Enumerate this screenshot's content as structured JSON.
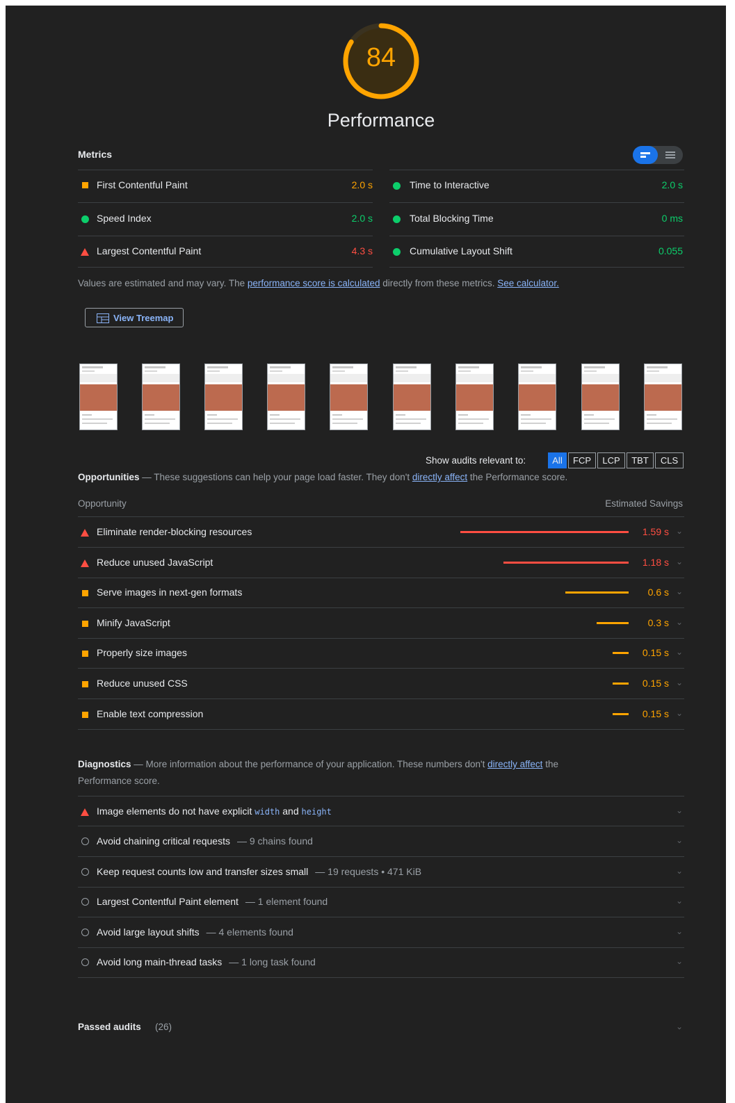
{
  "score": {
    "value": "84",
    "fraction": 0.84,
    "title": "Performance",
    "color": "#ffa400"
  },
  "colors": {
    "fail": "#ff4e42",
    "average": "#ffa400",
    "pass": "#0cce6b",
    "link": "#8ab4f8"
  },
  "metrics": {
    "heading": "Metrics",
    "left": [
      {
        "icon": "orange-square-icon",
        "label": "First Contentful Paint",
        "value": "2.0 s"
      },
      {
        "icon": "green-circle-icon",
        "label": "Speed Index",
        "value": "2.0 s"
      },
      {
        "icon": "red-triangle-icon",
        "label": "Largest Contentful Paint",
        "value": "4.3 s"
      }
    ],
    "right": [
      {
        "icon": "green-circle-icon",
        "label": "Time to Interactive",
        "value": "2.0 s"
      },
      {
        "icon": "green-circle-icon",
        "label": "Total Blocking Time",
        "value": "0 ms"
      },
      {
        "icon": "green-circle-icon",
        "label": "Cumulative Layout Shift",
        "value": "0.055"
      }
    ],
    "note": {
      "pre": "Values are estimated and may vary. The ",
      "link1": "performance score is calculated",
      "mid": " directly from these metrics. ",
      "link2": "See calculator."
    }
  },
  "treemap_button": "View Treemap",
  "filmstrip": {
    "frames": 10,
    "thumb_text": "Screenshot"
  },
  "filter": {
    "label": "Show audits relevant to:",
    "options": [
      "All",
      "FCP",
      "LCP",
      "TBT",
      "CLS"
    ],
    "selected": "All"
  },
  "opportunities": {
    "heading": "Opportunities",
    "desc_pre": " — These suggestions can help your page load faster. They don't ",
    "desc_link": "directly affect",
    "desc_post": " the Performance score.",
    "col_left": "Opportunity",
    "col_right": "Estimated Savings",
    "items": [
      {
        "label": "Eliminate render-blocking resources",
        "savings": "1.59 s",
        "seconds": 1.59,
        "rating": "fail"
      },
      {
        "label": "Reduce unused JavaScript",
        "savings": "1.18 s",
        "seconds": 1.18,
        "rating": "fail"
      },
      {
        "label": "Serve images in next-gen formats",
        "savings": "0.6 s",
        "seconds": 0.6,
        "rating": "average"
      },
      {
        "label": "Minify JavaScript",
        "savings": "0.3 s",
        "seconds": 0.3,
        "rating": "average"
      },
      {
        "label": "Properly size images",
        "savings": "0.15 s",
        "seconds": 0.15,
        "rating": "average"
      },
      {
        "label": "Reduce unused CSS",
        "savings": "0.15 s",
        "seconds": 0.15,
        "rating": "average"
      },
      {
        "label": "Enable text compression",
        "savings": "0.15 s",
        "seconds": 0.15,
        "rating": "average"
      }
    ]
  },
  "diagnostics": {
    "heading": "Diagnostics",
    "desc_pre": " — More information about the performance of your application. These numbers don't ",
    "desc_link": "directly affect",
    "desc_post": " the",
    "desc_line2": "Performance score.",
    "first": {
      "pre": "Image elements do not have explicit ",
      "code1": "width",
      "mid": " and ",
      "code2": "height"
    },
    "items": [
      {
        "label": "Avoid chaining critical requests",
        "detail": "— 9 chains found"
      },
      {
        "label": "Keep request counts low and transfer sizes small",
        "detail": "— 19 requests • 471 KiB"
      },
      {
        "label": "Largest Contentful Paint element",
        "detail": "— 1 element found"
      },
      {
        "label": "Avoid large layout shifts",
        "detail": "— 4 elements found"
      },
      {
        "label": "Avoid long main-thread tasks",
        "detail": "— 1 long task found"
      }
    ]
  },
  "passed": {
    "label": "Passed audits",
    "count": "(26)"
  }
}
